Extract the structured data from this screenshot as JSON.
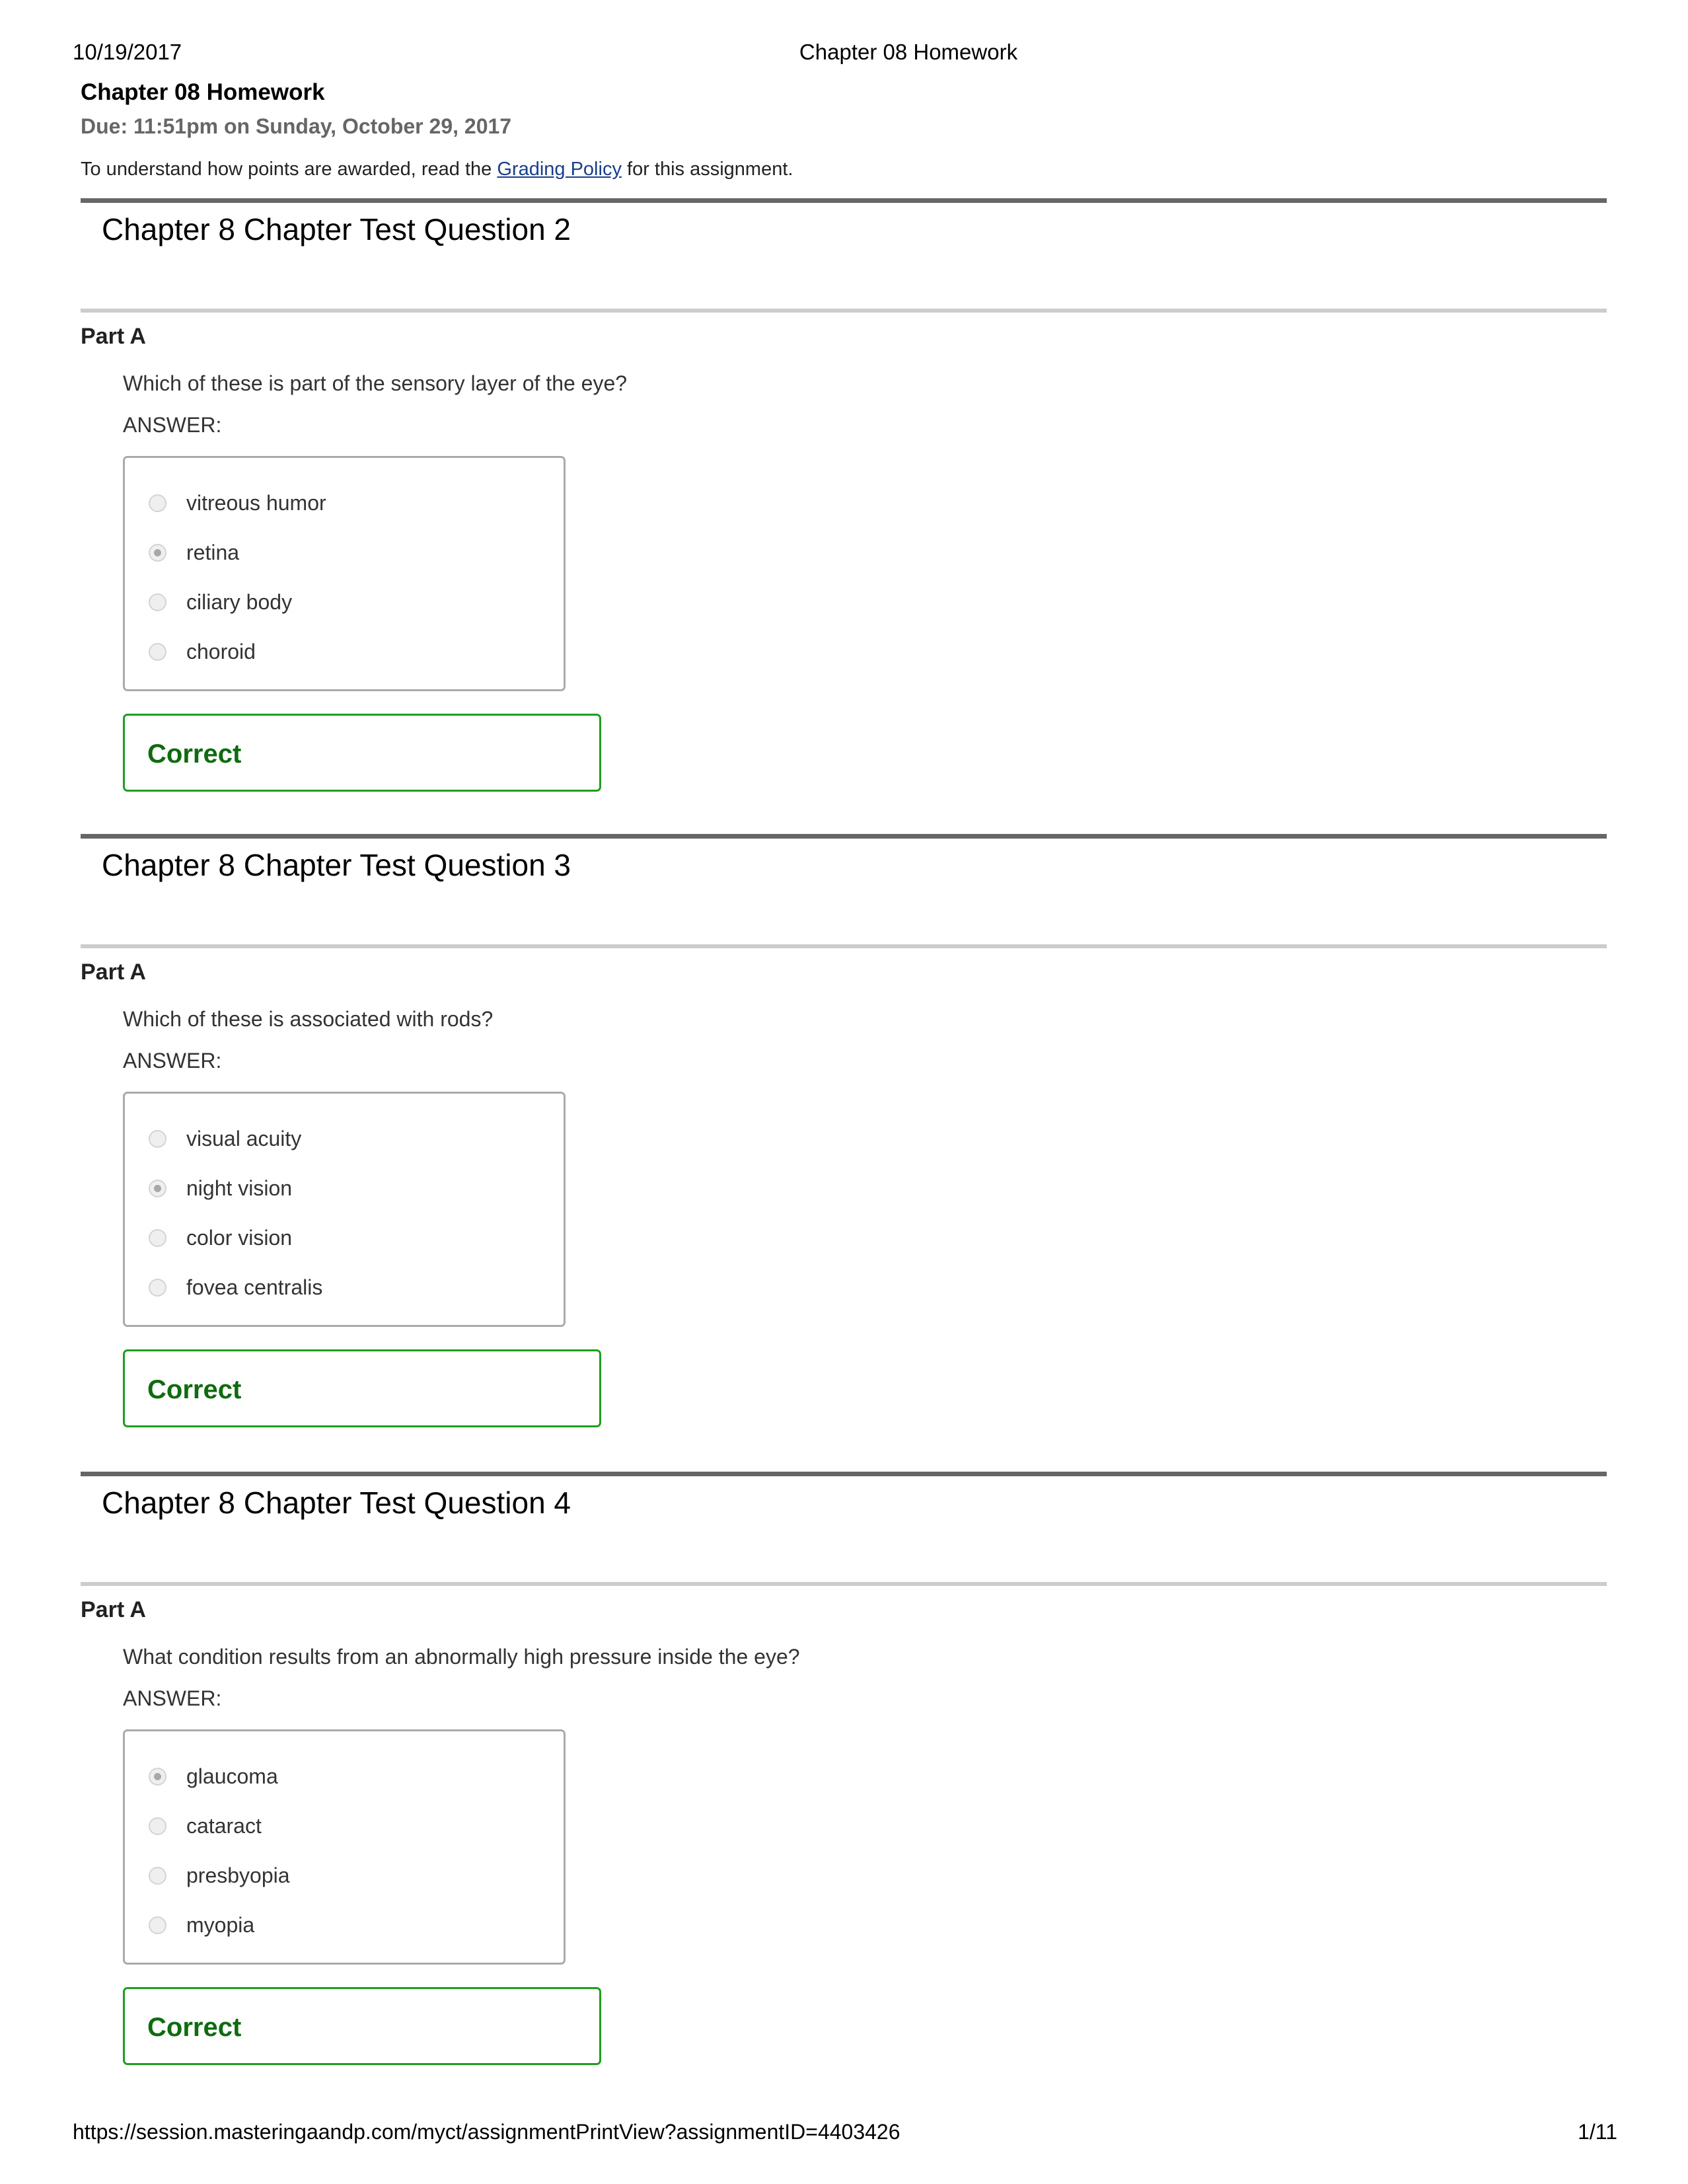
{
  "print_header": {
    "date": "10/19/2017",
    "title": "Chapter 08 Homework"
  },
  "assignment": {
    "title": "Chapter 08 Homework",
    "due": "Due: 11:51pm on Sunday, October 29, 2017",
    "policy_prefix": "To understand how points are awarded, read the ",
    "policy_link": "Grading Policy",
    "policy_suffix": " for this assignment."
  },
  "questions": [
    {
      "title": "Chapter 8 Chapter Test Question 2",
      "part": "Part A",
      "text": "Which of these is part of the sensory layer of the eye?",
      "answer_label": "ANSWER:",
      "options": [
        {
          "label": "vitreous humor",
          "selected": false
        },
        {
          "label": "retina",
          "selected": true
        },
        {
          "label": "ciliary body",
          "selected": false
        },
        {
          "label": "choroid",
          "selected": false
        }
      ],
      "result": "Correct"
    },
    {
      "title": "Chapter 8 Chapter Test Question 3",
      "part": "Part A",
      "text": "Which of these is associated with rods?",
      "answer_label": "ANSWER:",
      "options": [
        {
          "label": "visual acuity",
          "selected": false
        },
        {
          "label": "night vision",
          "selected": true
        },
        {
          "label": "color vision",
          "selected": false
        },
        {
          "label": "fovea centralis",
          "selected": false
        }
      ],
      "result": "Correct"
    },
    {
      "title": "Chapter 8 Chapter Test Question 4",
      "part": "Part A",
      "text": "What condition results from an abnormally high pressure inside the eye?",
      "answer_label": "ANSWER:",
      "options": [
        {
          "label": "glaucoma",
          "selected": true
        },
        {
          "label": "cataract",
          "selected": false
        },
        {
          "label": "presbyopia",
          "selected": false
        },
        {
          "label": "myopia",
          "selected": false
        }
      ],
      "result": "Correct"
    }
  ],
  "print_footer": {
    "url": "https://session.masteringaandp.com/myct/assignmentPrintView?assignmentID=4403426",
    "page": "1/11"
  },
  "colors": {
    "correct_text": "#0f6b0f",
    "correct_border": "#1e9e1e",
    "link": "#1a3e8c",
    "divider_primary": "#666666",
    "divider_secondary": "#cccccc"
  }
}
